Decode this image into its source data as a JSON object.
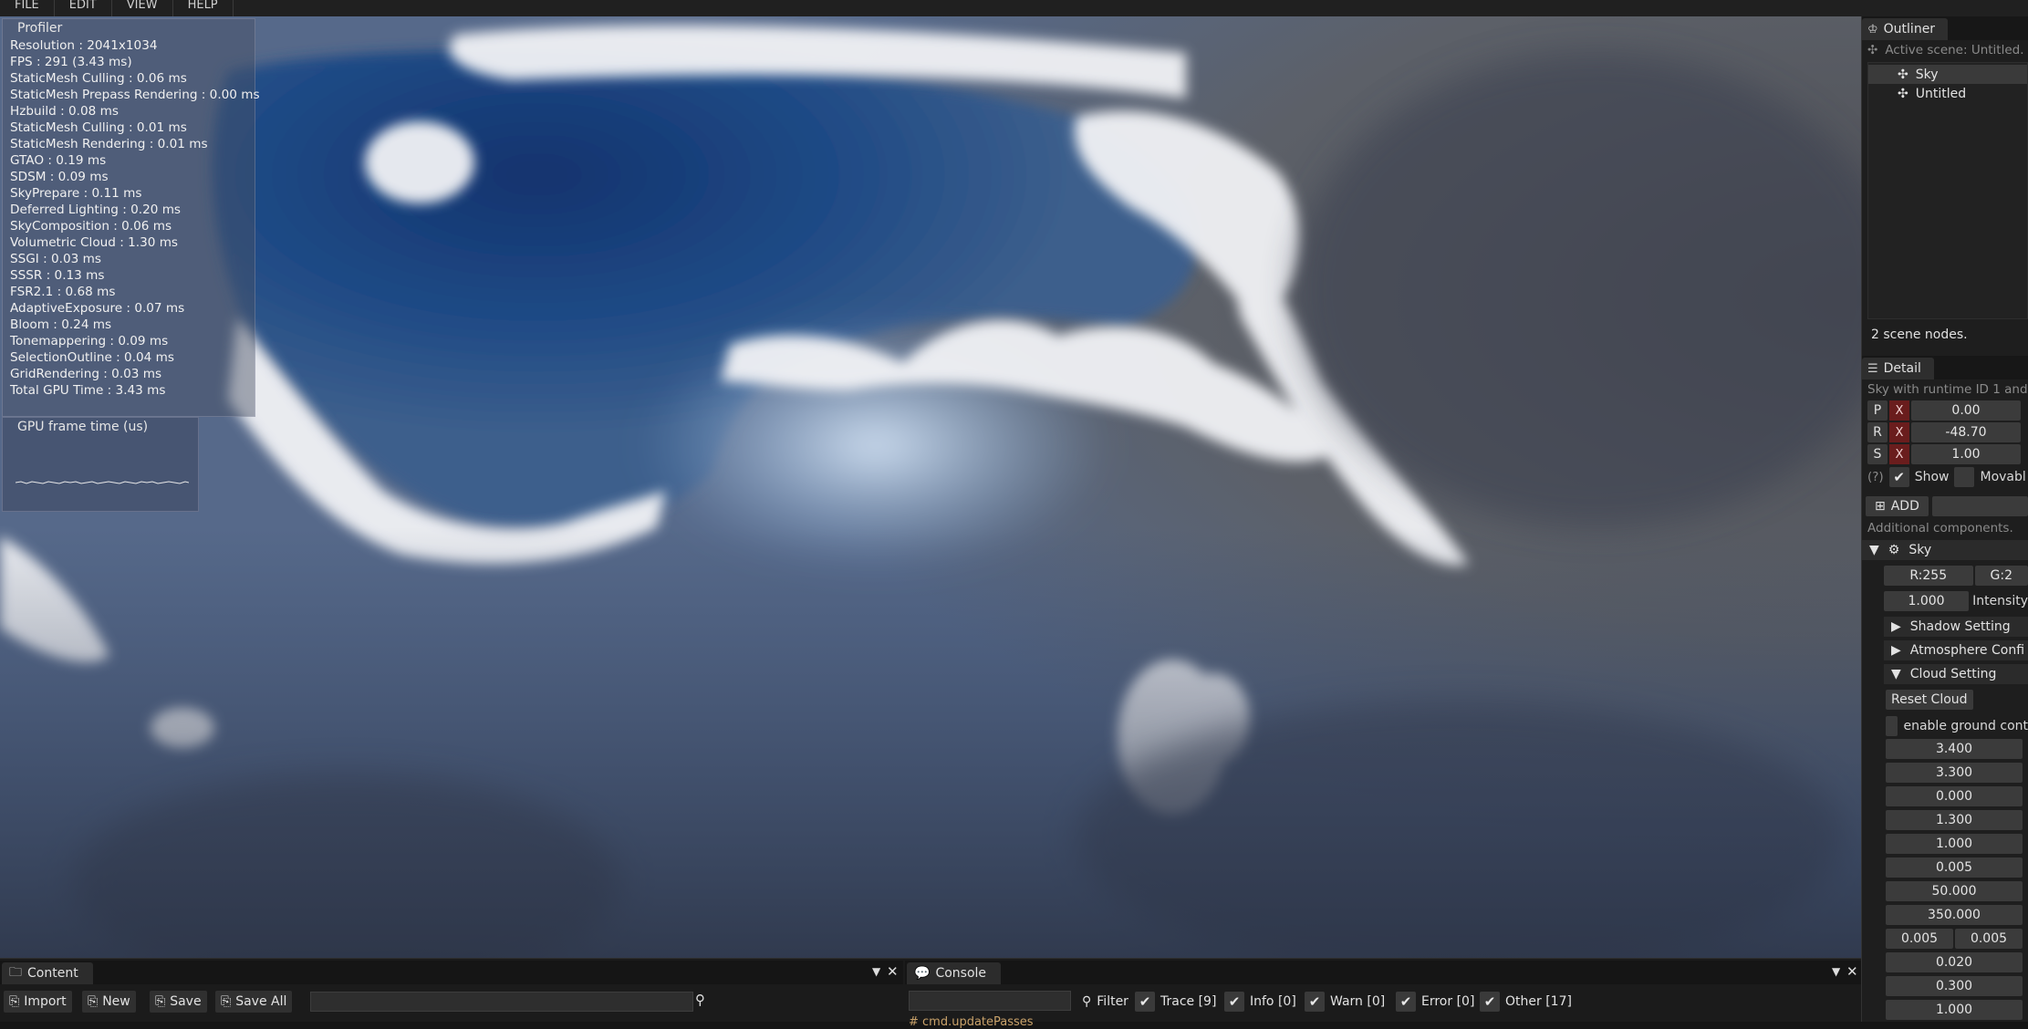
{
  "menu": [
    "FILE",
    "EDIT",
    "VIEW",
    "HELP"
  ],
  "profiler": {
    "title": "Profiler",
    "lines": [
      "Resolution : 2041x1034",
      "FPS : 291 (3.43 ms)",
      "StaticMesh Culling : 0.06 ms",
      "StaticMesh Prepass Rendering : 0.00 ms",
      "Hzbuild : 0.08 ms",
      "StaticMesh Culling : 0.01 ms",
      "StaticMesh Rendering : 0.01 ms",
      "GTAO : 0.19 ms",
      "SDSM : 0.09 ms",
      "SkyPrepare : 0.11 ms",
      "Deferred Lighting : 0.20 ms",
      "SkyComposition : 0.06 ms",
      "Volumetric Cloud : 1.30 ms",
      "SSGI : 0.03 ms",
      "SSSR : 0.13 ms",
      "FSR2.1 : 0.68 ms",
      "AdaptiveExposure : 0.07 ms",
      "Bloom : 0.24 ms",
      "Tonemappering : 0.09 ms",
      "SelectionOutline : 0.04 ms",
      "GridRendering : 0.03 ms",
      "Total GPU Time : 3.43 ms"
    ]
  },
  "gpu_panel": {
    "title": "GPU frame time (us)"
  },
  "outliner": {
    "tab": "Outliner",
    "active_scene": "Active scene:  Untitled.",
    "items": [
      "Sky",
      "Untitled"
    ],
    "count": "2 scene nodes."
  },
  "detail": {
    "tab": "Detail",
    "subtitle": "Sky with runtime ID 1 and c",
    "transform": [
      {
        "label": "P",
        "axis": "X",
        "value": "0.00"
      },
      {
        "label": "R",
        "axis": "X",
        "value": "-48.70"
      },
      {
        "label": "S",
        "axis": "X",
        "value": "1.00"
      }
    ],
    "help": "(?)",
    "show_label": "Show",
    "movable_label": "Movabl",
    "add_label": "ADD",
    "additional": "Additional components.",
    "sky_section": "Sky",
    "color_r": "R:255",
    "color_g": "G:2",
    "intensity_value": "1.000",
    "intensity_label": "Intensity",
    "shadow_setting": "Shadow Setting",
    "atmosphere_config": "Atmosphere Confi",
    "cloud_setting": "Cloud Setting",
    "reset_cloud": "Reset Cloud",
    "ground_contrib": "enable ground cont",
    "cloud_values": [
      "3.400",
      "3.300",
      "0.000",
      "1.300",
      "1.000",
      "0.005",
      "50.000",
      "350.000"
    ],
    "pair_values": [
      "0.005",
      "0.005"
    ],
    "tail_values": [
      "0.020",
      "0.300",
      "1.000"
    ]
  },
  "content": {
    "tab": "Content",
    "buttons": [
      "Import",
      "New",
      "Save",
      "Save All"
    ]
  },
  "console": {
    "tab": "Console",
    "filter": "Filter",
    "filters": [
      "Trace [9]",
      "Info [0]",
      "Warn [0]",
      "Error [0]",
      "Other [17]"
    ],
    "first_line": "# cmd.updatePasses"
  }
}
